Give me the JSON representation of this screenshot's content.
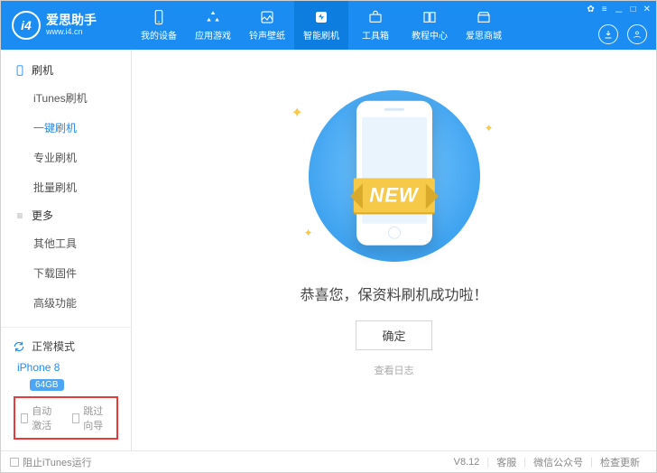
{
  "logo": {
    "badge": "i4",
    "title": "爱思助手",
    "subtitle": "www.i4.cn"
  },
  "tabs": [
    {
      "label": "我的设备"
    },
    {
      "label": "应用游戏"
    },
    {
      "label": "铃声壁纸"
    },
    {
      "label": "智能刷机"
    },
    {
      "label": "工具箱"
    },
    {
      "label": "教程中心"
    },
    {
      "label": "爱思商城"
    }
  ],
  "sidebar": {
    "group1": {
      "title": "刷机",
      "items": [
        "iTunes刷机",
        "一键刷机",
        "专业刷机",
        "批量刷机"
      ]
    },
    "group2": {
      "title": "更多",
      "items": [
        "其他工具",
        "下载固件",
        "高级功能"
      ]
    },
    "mode": "正常模式",
    "device": {
      "name": "iPhone 8",
      "storage": "64GB"
    },
    "checks": {
      "auto_activate": "自动激活",
      "skip_guide": "跳过向导"
    }
  },
  "main": {
    "banner_text": "NEW",
    "message": "恭喜您，保资料刷机成功啦！",
    "ok": "确定",
    "view_log": "查看日志"
  },
  "footer": {
    "block_itunes": "阻止iTunes运行",
    "version": "V8.12",
    "support": "客服",
    "wechat": "微信公众号",
    "update": "检查更新"
  }
}
